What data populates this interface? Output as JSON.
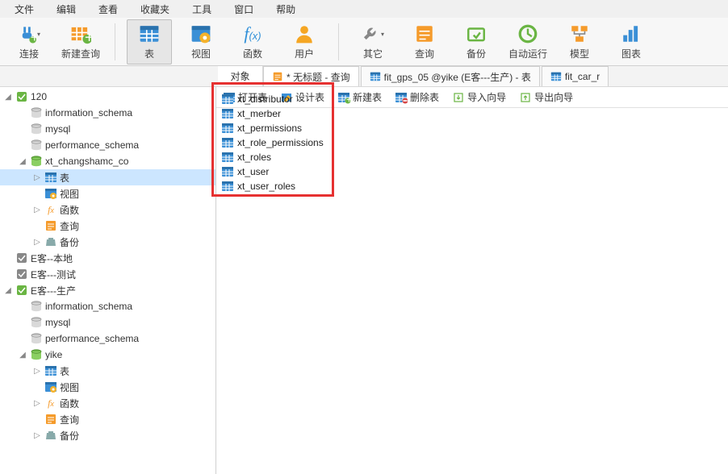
{
  "menu": {
    "items": [
      "文件",
      "编辑",
      "查看",
      "收藏夹",
      "工具",
      "窗口",
      "帮助"
    ]
  },
  "toolbar": [
    {
      "name": "connect",
      "label": "连接",
      "icon": "plug",
      "drop": true
    },
    {
      "name": "new-query",
      "label": "新建查询",
      "icon": "grid-plus"
    },
    {
      "name": "table",
      "label": "表",
      "icon": "table",
      "selected": true
    },
    {
      "name": "view",
      "label": "视图",
      "icon": "view"
    },
    {
      "name": "function",
      "label": "函数",
      "icon": "fx"
    },
    {
      "name": "user",
      "label": "用户",
      "icon": "user"
    },
    {
      "name": "other",
      "label": "其它",
      "icon": "wrench",
      "drop": true
    },
    {
      "name": "query",
      "label": "查询",
      "icon": "query"
    },
    {
      "name": "backup",
      "label": "备份",
      "icon": "backup"
    },
    {
      "name": "auto",
      "label": "自动运行",
      "icon": "clock"
    },
    {
      "name": "model",
      "label": "模型",
      "icon": "model"
    },
    {
      "name": "chart",
      "label": "图表",
      "icon": "chart"
    }
  ],
  "tabs": {
    "object_label": "对象",
    "items": [
      {
        "name": "untitled",
        "label": "* 无标题 - 查询",
        "icon": "query"
      },
      {
        "name": "fit-gps",
        "label": "fit_gps_05 @yike (E客---生产) - 表",
        "icon": "table"
      },
      {
        "name": "fit-car",
        "label": "fit_car_r",
        "icon": "table"
      }
    ]
  },
  "actions": [
    {
      "name": "open-table",
      "label": "打开表",
      "icon": "table"
    },
    {
      "name": "design-table",
      "label": "设计表",
      "icon": "design"
    },
    {
      "name": "new-table",
      "label": "新建表",
      "icon": "table-plus"
    },
    {
      "name": "delete-table",
      "label": "删除表",
      "icon": "table-del"
    },
    {
      "name": "import",
      "label": "导入向导",
      "icon": "import"
    },
    {
      "name": "export",
      "label": "导出向导",
      "icon": "export"
    }
  ],
  "tree": [
    {
      "d": 0,
      "t": "conn-on",
      "tw": "open",
      "label": "120"
    },
    {
      "d": 1,
      "t": "db",
      "label": "information_schema"
    },
    {
      "d": 1,
      "t": "db",
      "label": "mysql"
    },
    {
      "d": 1,
      "t": "db",
      "label": "performance_schema"
    },
    {
      "d": 1,
      "t": "db-on",
      "tw": "open",
      "label": "xt_changshamc_co"
    },
    {
      "d": 2,
      "t": "table",
      "tw": "close",
      "label": "表",
      "sel": true
    },
    {
      "d": 2,
      "t": "view",
      "label": "视图"
    },
    {
      "d": 2,
      "t": "fx",
      "tw": "close",
      "label": "函数"
    },
    {
      "d": 2,
      "t": "query",
      "label": "查询"
    },
    {
      "d": 2,
      "t": "backup",
      "tw": "close",
      "label": "备份"
    },
    {
      "d": 0,
      "t": "conn",
      "label": "E客--本地"
    },
    {
      "d": 0,
      "t": "conn",
      "label": "E客---测试"
    },
    {
      "d": 0,
      "t": "conn-on",
      "tw": "open",
      "label": "E客---生产"
    },
    {
      "d": 1,
      "t": "db",
      "label": "information_schema"
    },
    {
      "d": 1,
      "t": "db",
      "label": "mysql"
    },
    {
      "d": 1,
      "t": "db",
      "label": "performance_schema"
    },
    {
      "d": 1,
      "t": "db-on",
      "tw": "open",
      "label": "yike"
    },
    {
      "d": 2,
      "t": "table",
      "tw": "close",
      "label": "表"
    },
    {
      "d": 2,
      "t": "view",
      "label": "视图"
    },
    {
      "d": 2,
      "t": "fx",
      "tw": "close",
      "label": "函数"
    },
    {
      "d": 2,
      "t": "query",
      "label": "查询"
    },
    {
      "d": 2,
      "t": "backup",
      "tw": "close",
      "label": "备份"
    }
  ],
  "tables": [
    "xt_distributor",
    "xt_merber",
    "xt_permissions",
    "xt_role_permissions",
    "xt_roles",
    "xt_user",
    "xt_user_roles"
  ],
  "colors": {
    "accent": "#2f8fd8",
    "green": "#6ab543",
    "red": "#e63131",
    "orange": "#f59b2b",
    "gray": "#888"
  }
}
